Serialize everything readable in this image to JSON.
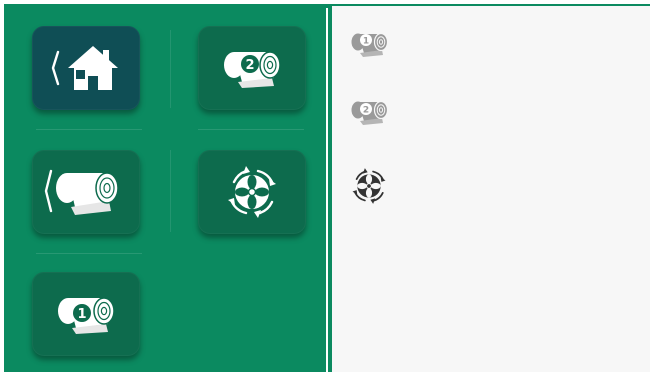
{
  "colors": {
    "panel": "#0b8a60",
    "tile": "#0d6b4d",
    "tile_active": "#0f4e55",
    "icon_white": "#ffffff",
    "icon_gray": "#9a9a9a",
    "icon_dark": "#333333"
  },
  "tiles": [
    {
      "name": "home-back-button",
      "icon": "home-icon",
      "active": true
    },
    {
      "name": "roller-2-button",
      "icon": "roller-2-icon",
      "badge": "2"
    },
    {
      "name": "roller-back-button",
      "icon": "roller-icon"
    },
    {
      "name": "fan-rotation-button",
      "icon": "fan-rotation-icon"
    },
    {
      "name": "roller-1-button",
      "icon": "roller-1-icon",
      "badge": "1"
    }
  ],
  "status_list": [
    {
      "name": "roller-1-status",
      "icon": "roller-1-icon",
      "badge": "1"
    },
    {
      "name": "roller-2-status",
      "icon": "roller-2-icon",
      "badge": "2"
    },
    {
      "name": "fan-status",
      "icon": "fan-rotation-icon"
    }
  ]
}
